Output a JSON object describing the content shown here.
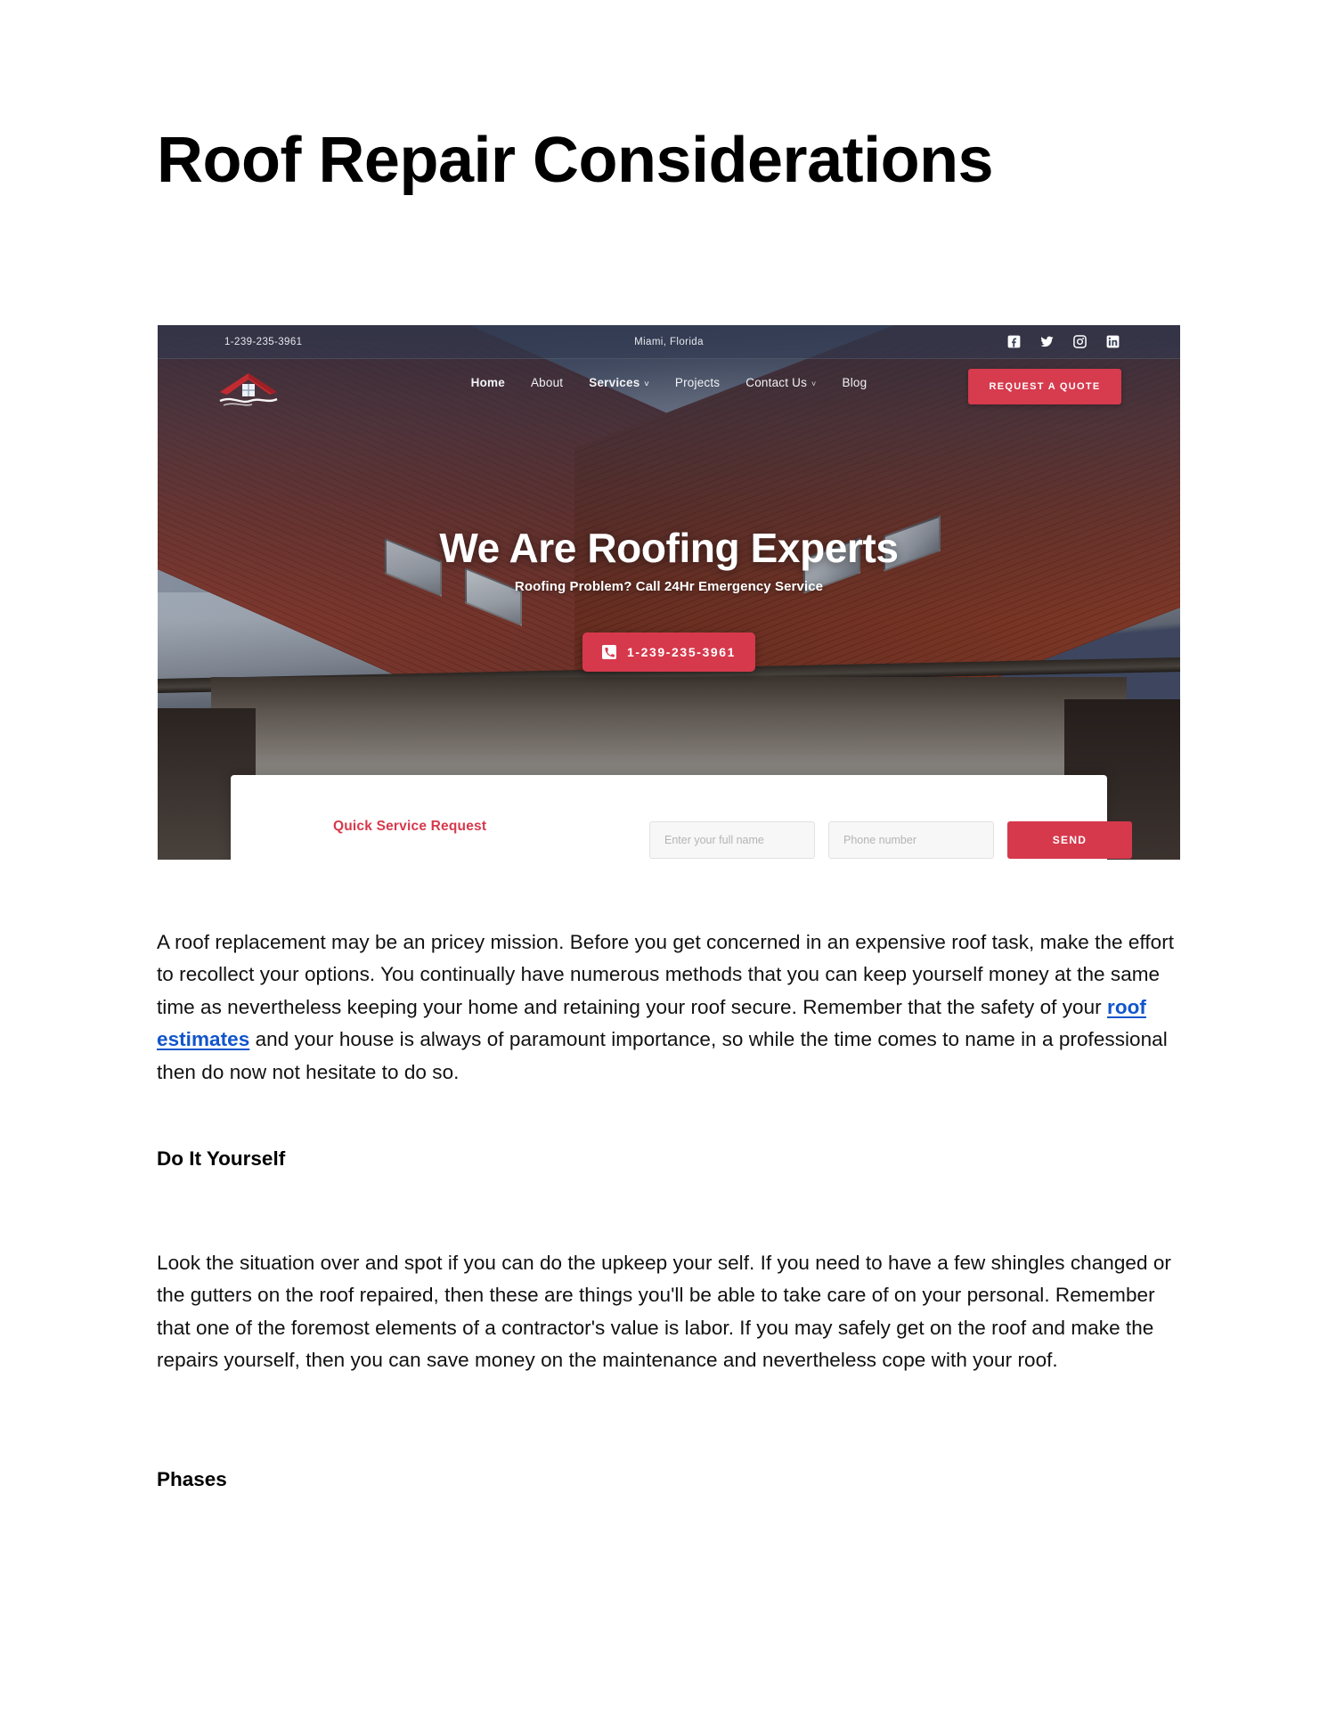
{
  "document": {
    "title": "Roof Repair Considerations"
  },
  "website_screenshot": {
    "topbar": {
      "phone": "1-239-235-3961",
      "location": "Miami, Florida",
      "socials": [
        "facebook-icon",
        "twitter-icon",
        "instagram-icon",
        "linkedin-icon"
      ]
    },
    "nav": {
      "logo_alt": "roof-house-logo",
      "items": [
        {
          "label": "Home",
          "active": true,
          "caret": ""
        },
        {
          "label": "About",
          "active": false,
          "caret": ""
        },
        {
          "label": "Services",
          "active": true,
          "caret": "˅"
        },
        {
          "label": "Projects",
          "active": false,
          "caret": ""
        },
        {
          "label": "Contact Us",
          "active": false,
          "caret": "˅"
        },
        {
          "label": "Blog",
          "active": false,
          "caret": ""
        }
      ],
      "quote_button": "REQUEST A QUOTE"
    },
    "hero": {
      "title": "We Are Roofing Experts",
      "subtitle": "Roofing Problem? Call 24Hr Emergency Service",
      "cta_phone": "1-239-235-3961",
      "cta_icon": "phone-icon"
    },
    "service_card": {
      "title": "Quick Service Request",
      "field_name_placeholder": "Enter your full name",
      "field_phone_placeholder": "Phone number",
      "send_button": "SEND"
    },
    "colors": {
      "accent_red": "#d6394c",
      "nav_dark": "#3d465e",
      "roof_red": "#8b3b2e"
    }
  },
  "article": {
    "paragraph_1_a": "A roof replacement may be an pricey mission. Before you get concerned in an expensive roof task, make the effort to recollect your options. You continually have numerous methods that you can keep yourself money at the same time as nevertheless keeping your home and retaining your roof secure. Remember that the safety of your ",
    "paragraph_1_link": "roof estimates",
    "paragraph_1_b": " and your house is always of paramount importance, so while the time comes to name in a professional then do now not hesitate to do so.",
    "heading_diy": "Do It Yourself",
    "paragraph_2": "Look the situation over and spot if you can do the upkeep your self. If you need to have a few shingles changed or the gutters on the roof repaired, then these are things you'll be able to take care of on your personal. Remember that one of the foremost elements of a contractor's value is labor. If you may safely get on the roof and make the repairs yourself, then you can save money on the maintenance and nevertheless cope with your roof.",
    "heading_phases": "Phases",
    "link_color": "#1155cc"
  }
}
